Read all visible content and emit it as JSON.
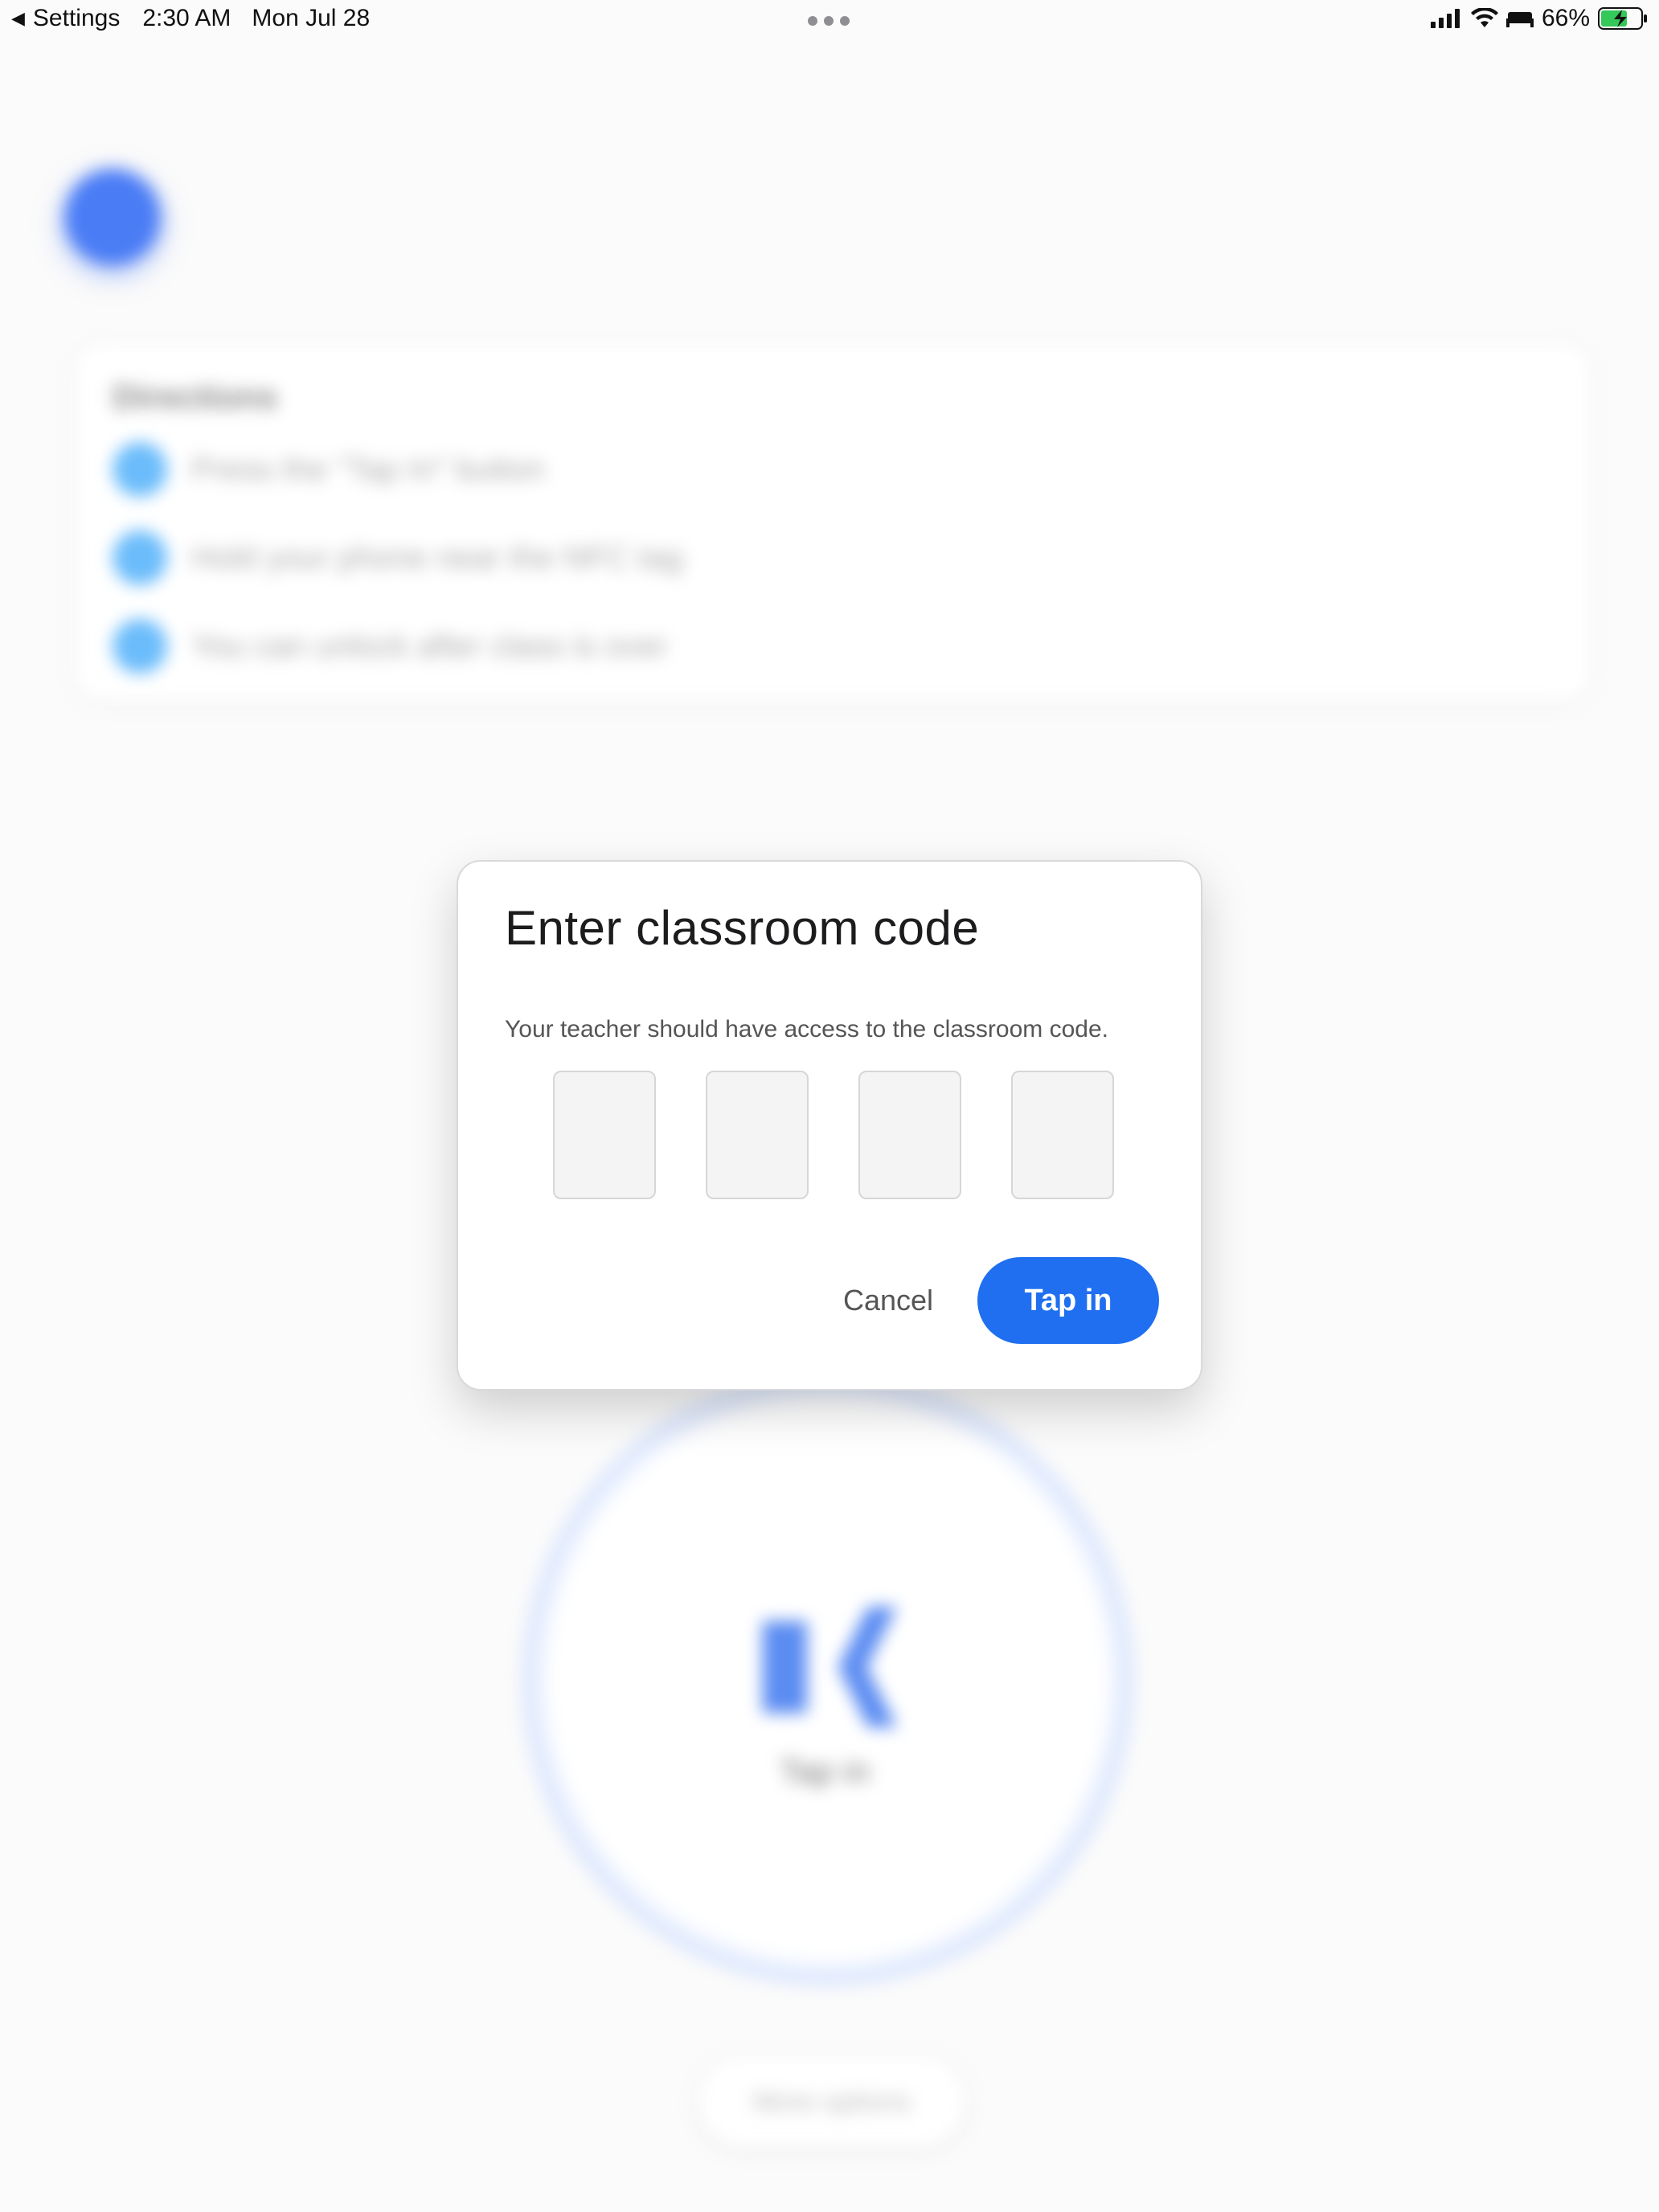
{
  "status_bar": {
    "back_label": "Settings",
    "time": "2:30 AM",
    "date": "Mon Jul 28",
    "battery_percent": "66%",
    "icons": [
      "signal-icon",
      "wifi-icon",
      "sleep-icon",
      "battery-icon"
    ]
  },
  "background": {
    "card_title": "Directions",
    "rows": [
      {
        "label": "Press the \"Tap In\" button"
      },
      {
        "label": "Hold your phone near the NFC tag"
      },
      {
        "label": "You can unlock after class is over"
      }
    ],
    "tap_label": "Tap in",
    "more_label": "More options"
  },
  "dialog": {
    "title": "Enter classroom code",
    "subtitle": "Your teacher should have access to the classroom code.",
    "code_digits": [
      "",
      "",
      "",
      ""
    ],
    "cancel_label": "Cancel",
    "submit_label": "Tap in"
  },
  "colors": {
    "accent": "#1f6ff0",
    "battery_charging": "#34c759"
  }
}
